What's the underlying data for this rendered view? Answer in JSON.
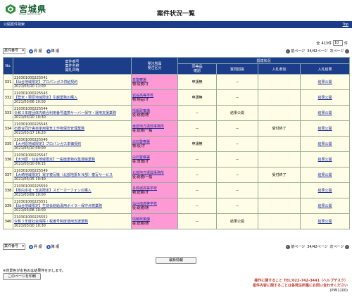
{
  "header": {
    "logo_text": "宮城県",
    "logo_sub": "MIYAGI PREFECTURE",
    "page_title": "案件状況一覧"
  },
  "section": {
    "title": "公開案件検索",
    "top_link": "Top"
  },
  "pagination": {
    "total_prefix": "全",
    "total_count": "413件",
    "page_size": "10",
    "page_size_suffix": "件",
    "prev_label": "前ページ",
    "next_label": "次ページ",
    "page_info": "34/42ページ"
  },
  "sort": {
    "selected": "案件番号",
    "asc_label": "昇 順",
    "desc_label": "降 順"
  },
  "table": {
    "headers": {
      "no": "No.",
      "case": [
        "案件番号",
        "案件名称",
        "開札日時"
      ],
      "org": [
        "発注所属",
        "発注区分"
      ],
      "survey_group": "調達状況",
      "equiv": [
        "同等品",
        "確認"
      ],
      "qa": "質問回答",
      "bid": "入札参加",
      "result": "入札結果"
    },
    "rows": [
      {
        "no": "331",
        "case_no": "210301000225541",
        "case_name": "【仙台地域限定】プロパンガス供給契約",
        "open_date": "2021/03/10 11:00",
        "org": "泉警察署",
        "cat": "物:役務/才",
        "equiv": "申請無",
        "qa": "－",
        "bid": "",
        "result": "結果公開"
      },
      {
        "no": "332",
        "case_no": "210301000225543",
        "case_name": "【登米・栗原地域限定】引越業務の購入",
        "open_date": "2021/03/08 10:00",
        "org": "岩谷高等学校",
        "cat": "物:物品/才",
        "equiv": "申請無",
        "qa": "－",
        "bid": "",
        "result": "結果公開"
      },
      {
        "no": "333",
        "case_no": "210301000225544",
        "case_name": "令和３年度団体内統合利用番号連携サーバー保守・運用支援業務",
        "open_date": "2021/03/10 10:30",
        "org": "情報政策課",
        "cat": "役:総務/随",
        "equiv": "－",
        "qa": "結果公開",
        "bid": "",
        "result": "結果公開"
      },
      {
        "no": "334",
        "case_no": "210301000225545",
        "case_name": "石巻合同庁舎自家用電気工作物保安管理業務",
        "open_date": "2021/03/17 16:20",
        "org": "東部地方振興事務所",
        "cat": "役:総務/一般",
        "equiv": "－",
        "qa": "－",
        "bid": "受付終了",
        "result": "結果公開"
      },
      {
        "no": "335",
        "case_no": "210301000225546",
        "case_name": "【大河原地域限定】プロパンガス単価契約",
        "open_date": "2021/03/10 09:00",
        "org": "白石警察署",
        "cat": "物:役/才",
        "equiv": "申請無",
        "qa": "－",
        "bid": "",
        "result": "結果公開"
      },
      {
        "no": "336",
        "case_no": "210301000225547",
        "case_name": "【大河原・仙台地域限定】一般廃棄物収集運搬業務",
        "open_date": "2021/03/10 09:15",
        "org": "白石警察署",
        "cat": "役:単価/才",
        "equiv": "－",
        "qa": "－",
        "bid": "",
        "result": "結果公開"
      },
      {
        "no": "337",
        "case_no": "210301000225549",
        "case_name": "【大崎地域限定】電子複写機（北部地振ＮＮ部）複写サービス",
        "open_date": "2021/03/15 10:30",
        "org": "北部地方振興事務所",
        "cat": "役:総務/一般",
        "equiv": "－",
        "qa": "－",
        "bid": "受付終了",
        "result": "結果公開"
      },
      {
        "no": "338",
        "case_no": "210301000225550",
        "case_name": "【県内本社・支店限定】スピーカーフォンの購入",
        "open_date": "2021/03/09 10:00",
        "org": "多賀城高等学校",
        "cat": "物:総務/才",
        "equiv": "－",
        "qa": "－",
        "bid": "",
        "result": "結果公開"
      },
      {
        "no": "339",
        "case_no": "210301000225551",
        "case_name": "【仙台地域限定】生徒会館給湯用ボイラー保守点検業務",
        "open_date": "2021/03/08 10:00",
        "org": "仙台南高等学校",
        "cat": "役:総務/随",
        "equiv": "－",
        "qa": "－",
        "bid": "",
        "result": "結果公開"
      },
      {
        "no": "340",
        "case_no": "210301000225552",
        "case_name": "令和３年度社会保障・税番号制度運用支援業務",
        "open_date": "2021/03/10 10:30",
        "org": "情報政策課",
        "cat": "役:総務/随",
        "equiv": "－",
        "qa": "結果公開",
        "bid": "",
        "result": "結果公開"
      }
    ]
  },
  "footer": {
    "refresh_label": "最新情報",
    "note": "※背景色が水色のは結果件を示します。",
    "print_label": "このページを印刷",
    "contact_line1": "操作に関すること TEL:022-742-3441（ヘルプデスク）",
    "contact_line2": "案件内容に関することは各発注所属にお問い合わせください",
    "page_code": "(PMI1100)"
  },
  "colors": {
    "nav_blue": "#1c3e8a",
    "org_pink": "#ff99d6",
    "row_cream": "#fffde6",
    "link_blue": "#1b2f9b",
    "contact_red": "#c0392b"
  }
}
